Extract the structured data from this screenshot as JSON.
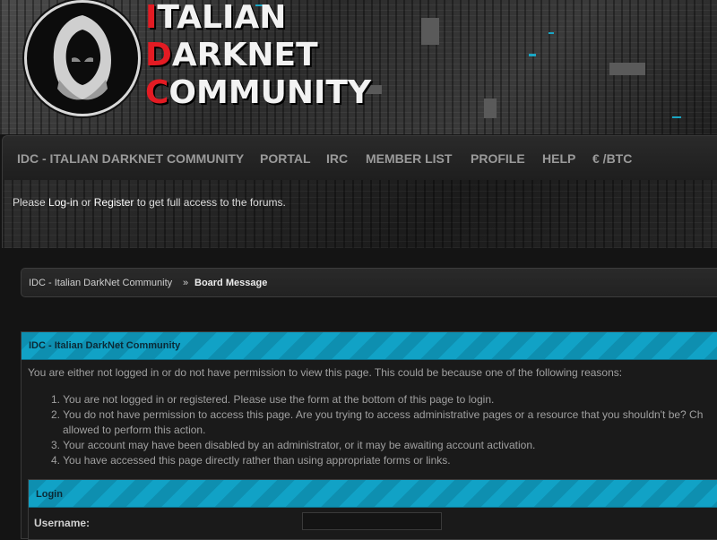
{
  "header": {
    "title_lines": [
      {
        "first": "I",
        "rest": "TALIAN"
      },
      {
        "first": "D",
        "rest": "ARKNET"
      },
      {
        "first": "C",
        "rest": "OMMUNITY"
      }
    ]
  },
  "nav": {
    "items": [
      "IDC - Italian DarkNet Community",
      "Portal",
      "IRC",
      "Member List",
      "Profile",
      "Help",
      "€ /BTC"
    ]
  },
  "login_note": {
    "prefix": "Please ",
    "login_link": "Log-in",
    "middle": " or ",
    "register_link": "Register",
    "suffix": " to get full access to the forums."
  },
  "breadcrumb": {
    "link": "IDC - Italian DarkNet Community",
    "separator": " » ",
    "current": "Board Message"
  },
  "panel": {
    "title": "IDC - Italian DarkNet Community",
    "intro": "You are either not logged in or do not have permission to view this page. This could be because one of the following reasons:",
    "reasons": [
      "1. You are not logged in or registered. Please use the form at the bottom of this page to login.",
      "2. You do not have permission to access this page. Are you trying to access administrative pages or a resource that you shouldn't be? Ch",
      "allowed to perform this action.",
      "3. Your account may have been disabled by an administrator, or it may be awaiting account activation.",
      "4. You have accessed this page directly rather than using appropriate forms or links."
    ]
  },
  "login_form": {
    "title": "Login",
    "username_label": "Username:",
    "username_value": ""
  },
  "colors": {
    "accent_teal": "#11a2c6",
    "logo_red": "#e31b23"
  }
}
